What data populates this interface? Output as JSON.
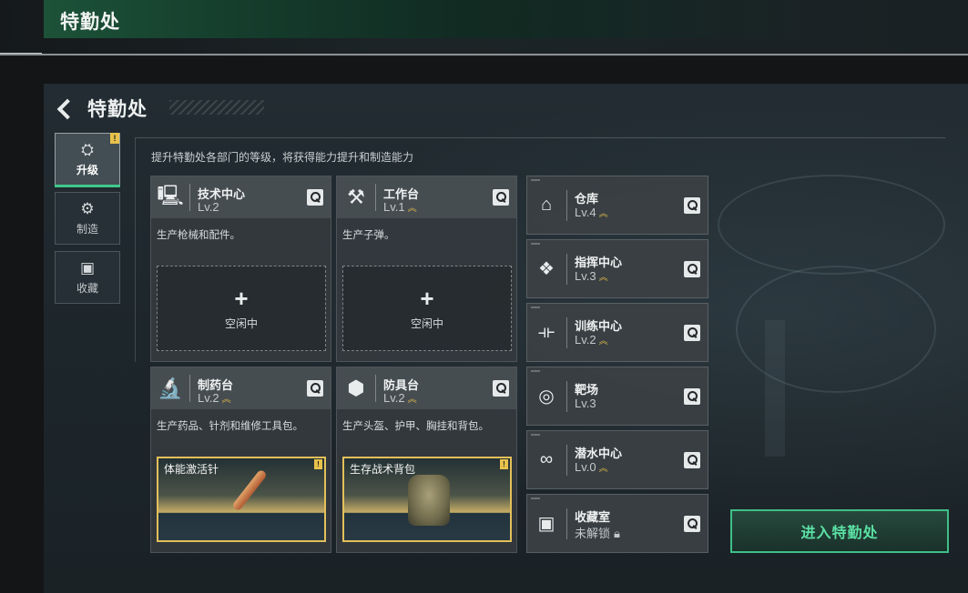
{
  "window": {
    "title": "特勤处"
  },
  "header": {
    "title": "特勤处"
  },
  "side_tabs": [
    {
      "label": "升级",
      "icon": "upgrade-icon",
      "active": true,
      "badge": "!"
    },
    {
      "label": "制造",
      "icon": "gear-icon",
      "active": false
    },
    {
      "label": "收藏",
      "icon": "collection-icon",
      "active": false
    }
  ],
  "description": "提升特勤处各部门的等级，将获得能力提升和制造能力",
  "cards": [
    {
      "name": "技术中心",
      "level": "Lv.2",
      "upgrade": false,
      "icon": "workstation-icon",
      "desc": "生产枪械和配件。",
      "slot": {
        "type": "idle",
        "plus": "+",
        "text": "空闲中"
      }
    },
    {
      "name": "工作台",
      "level": "Lv.1",
      "upgrade": true,
      "icon": "tools-icon",
      "desc": "生产子弹。",
      "slot": {
        "type": "idle",
        "plus": "+",
        "text": "空闲中"
      }
    },
    {
      "name": "制药台",
      "level": "Lv.2",
      "upgrade": true,
      "icon": "microscope-icon",
      "desc": "生产药品、针剂和维修工具包。",
      "slot": {
        "type": "product",
        "text": "体能激活针",
        "badge": "!"
      }
    },
    {
      "name": "防具台",
      "level": "Lv.2",
      "upgrade": true,
      "icon": "armor-icon",
      "desc": "生产头盔、护甲、胸挂和背包。",
      "slot": {
        "type": "product",
        "text": "生存战术背包",
        "badge": "!"
      }
    }
  ],
  "small_cards": [
    {
      "name": "仓库",
      "level": "Lv.4",
      "upgrade": true,
      "icon": "warehouse-icon"
    },
    {
      "name": "指挥中心",
      "level": "Lv.3",
      "upgrade": true,
      "icon": "command-chip-icon"
    },
    {
      "name": "训练中心",
      "level": "Lv.2",
      "upgrade": true,
      "icon": "dumbbell-icon"
    },
    {
      "name": "靶场",
      "level": "Lv.3",
      "upgrade": false,
      "icon": "target-icon"
    },
    {
      "name": "潜水中心",
      "level": "Lv.0",
      "upgrade": true,
      "icon": "diving-goggles-icon"
    },
    {
      "name": "收藏室",
      "level": "未解锁",
      "upgrade": false,
      "locked": true,
      "icon": "vault-icon"
    }
  ],
  "enter_button": "进入特勤处",
  "colors": {
    "accent_green": "#3fc98c",
    "upgrade_gold": "#d9b548",
    "badge_yellow": "#e8c24b"
  }
}
